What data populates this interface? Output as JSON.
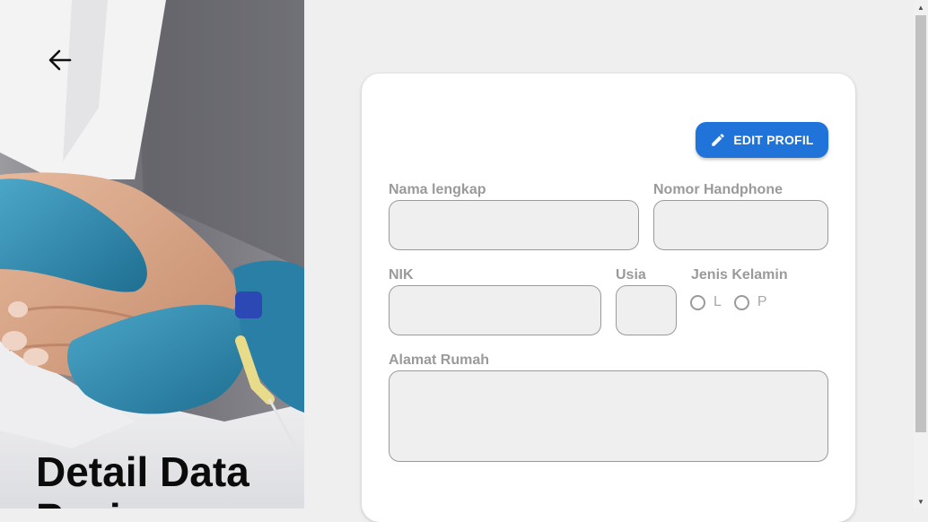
{
  "page": {
    "title": "Detail Data Pasien",
    "back_icon": "arrow-left-icon"
  },
  "card": {
    "edit_button": {
      "label": "EDIT PROFIL",
      "icon": "pencil-icon",
      "color": "#1f73d9"
    },
    "fields": {
      "nama": {
        "label": "Nama lengkap",
        "value": ""
      },
      "nomor_hp": {
        "label": "Nomor Handphone",
        "value": ""
      },
      "nik": {
        "label": "NIK",
        "value": ""
      },
      "usia": {
        "label": "Usia",
        "value": ""
      },
      "jenis_kelamin": {
        "label": "Jenis Kelamin",
        "options": [
          "L",
          "P"
        ],
        "selected": null
      },
      "alamat": {
        "label": "Alamat Rumah",
        "value": ""
      }
    }
  },
  "colors": {
    "background": "#efefef",
    "card": "#ffffff",
    "label": "#9a9a9a",
    "input_fill": "#efefef"
  }
}
